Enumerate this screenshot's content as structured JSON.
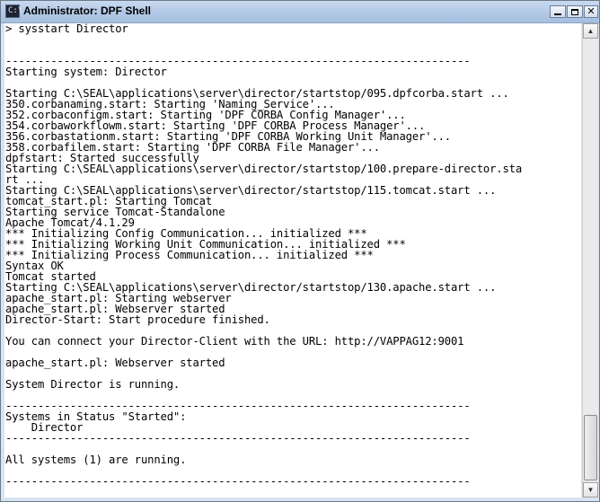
{
  "window": {
    "title": "Administrator: DPF Shell",
    "icon": "console-icon",
    "icon_glyph": "C:\\"
  },
  "controls": {
    "minimize": "minimize-icon",
    "maximize": "maximize-icon",
    "close": "close-icon",
    "close_glyph": "✕"
  },
  "scrollbar": {
    "up_glyph": "▲",
    "down_glyph": "▼"
  },
  "console": {
    "lines": [
      "> sysstart Director",
      "",
      "",
      "------------------------------------------------------------------------",
      "Starting system: Director",
      "",
      "Starting C:\\SEAL\\applications\\server\\director/startstop/095.dpfcorba.start ...",
      "350.corbanaming.start: Starting 'Naming_Service'...",
      "352.corbaconfigm.start: Starting 'DPF CORBA Config Manager'...",
      "354.corbaworkflowm.start: Starting 'DPF CORBA Process Manager'...",
      "356.corbastationm.start: Starting 'DPF CORBA Working Unit Manager'...",
      "358.corbafilem.start: Starting 'DPF CORBA File Manager'...",
      "dpfstart: Started successfully",
      "Starting C:\\SEAL\\applications\\server\\director/startstop/100.prepare-director.sta",
      "rt ...",
      "Starting C:\\SEAL\\applications\\server\\director/startstop/115.tomcat.start ...",
      "tomcat_start.pl: Starting Tomcat",
      "Starting service Tomcat-Standalone",
      "Apache Tomcat/4.1.29",
      "*** Initializing Config Communication... initialized ***",
      "*** Initializing Working Unit Communication... initialized ***",
      "*** Initializing Process Communication... initialized ***",
      "Syntax OK",
      "Tomcat started",
      "Starting C:\\SEAL\\applications\\server\\director/startstop/130.apache.start ...",
      "apache_start.pl: Starting webserver",
      "apache_start.pl: Webserver started",
      "Director-Start: Start procedure finished.",
      "",
      "You can connect your Director-Client with the URL: http://VAPPAG12:9001",
      "",
      "apache_start.pl: Webserver started",
      "",
      "System Director is running.",
      "",
      "------------------------------------------------------------------------",
      "Systems in Status \"Started\":",
      "    Director",
      "------------------------------------------------------------------------",
      "",
      "All systems (1) are running.",
      "",
      "------------------------------------------------------------------------"
    ]
  }
}
